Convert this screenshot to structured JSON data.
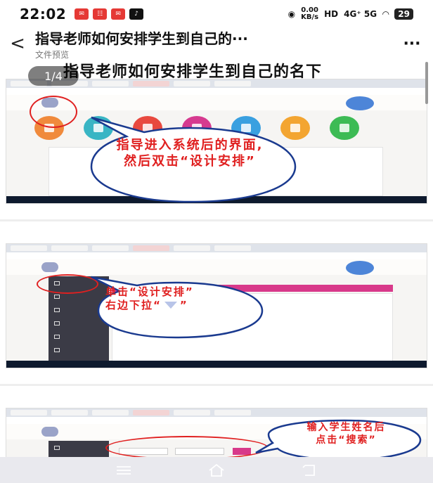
{
  "status_bar": {
    "time": "22:02",
    "speed_value": "0.00",
    "speed_unit": "KB/s",
    "network": "4G⁺ 5G",
    "battery": "29"
  },
  "header": {
    "back_icon": "chevron-left-icon",
    "title": "指导老师如何安排学生到自己的···",
    "subtitle": "文件预览",
    "more_label": "···"
  },
  "document": {
    "heading": "指导老师如何安排学生到自己的名下",
    "page_indicator": "1/4",
    "steps": [
      {
        "callout_lines": [
          "指导进入系统后的界面,",
          "然后双击“设计安排”"
        ]
      },
      {
        "callout_lines": [
          "单击“设计安排”",
          "右边下拉“",
          "”"
        ]
      },
      {
        "callout_lines": [
          "输入学生姓名后",
          "点击“搜索”"
        ]
      }
    ]
  },
  "system_nav": {
    "menu_icon": "menu-icon",
    "home_icon": "home-icon",
    "back_icon": "back-icon"
  },
  "colors": {
    "callout_red": "#e02020",
    "accent_pink": "#d8398a",
    "blob_blue": "#4d85d8"
  }
}
